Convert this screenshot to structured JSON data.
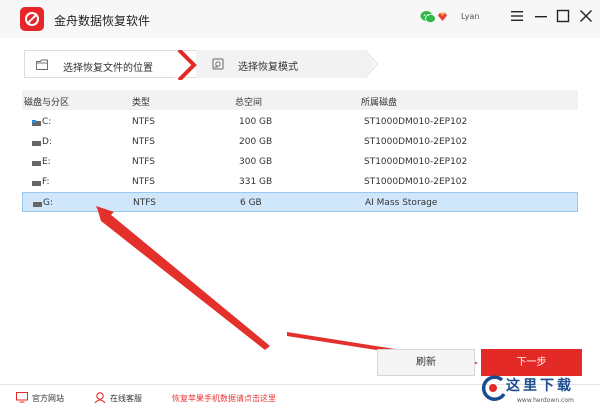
{
  "app": {
    "title": "金舟数据恢复软件",
    "user": "Lyan"
  },
  "steps": [
    {
      "label": "选择恢复文件的位置"
    },
    {
      "label": "选择恢复模式"
    }
  ],
  "table": {
    "headers": [
      "磁盘与分区",
      "类型",
      "总空间",
      "所属磁盘"
    ],
    "rows": [
      {
        "name": "C:",
        "type": "NTFS",
        "size": "100 GB",
        "model": "ST1000DM010-2EP102"
      },
      {
        "name": "D:",
        "type": "NTFS",
        "size": "200 GB",
        "model": "ST1000DM010-2EP102"
      },
      {
        "name": "E:",
        "type": "NTFS",
        "size": "300 GB",
        "model": "ST1000DM010-2EP102"
      },
      {
        "name": "F:",
        "type": "NTFS",
        "size": "331 GB",
        "model": "ST1000DM010-2EP102"
      },
      {
        "name": "G:",
        "type": "NTFS",
        "size": "6 GB",
        "model": "AI Mass Storage"
      }
    ]
  },
  "buttons": {
    "refresh": "刷新",
    "next": "下一步"
  },
  "footer": {
    "website": "官方网站",
    "support": "在线客服",
    "promo": "恢复苹果手机数据请点击这里"
  },
  "watermark": {
    "brand": "这里下载",
    "url": "www.herdown.com"
  },
  "icons": {
    "logo": "jinzhou-logo-icon",
    "wechat": "wechat-icon",
    "vip": "vip-diamond-icon",
    "menu": "menu-icon",
    "minimize": "minimize-icon",
    "maximize": "maximize-icon",
    "close": "close-icon"
  },
  "colors": {
    "brand": "#e42a27",
    "selection": "#cfe6fb",
    "annotation": "#e3302b"
  },
  "selected_row": "G:"
}
